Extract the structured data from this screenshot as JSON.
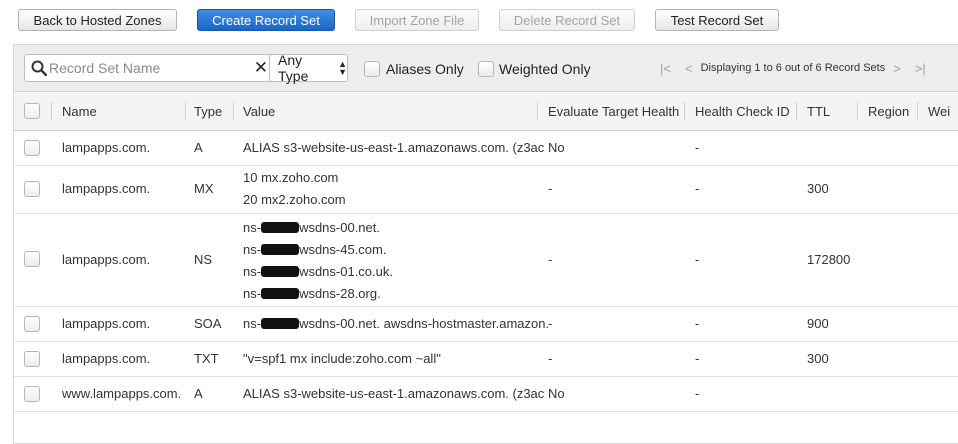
{
  "toolbar": {
    "back": "Back to Hosted Zones",
    "create": "Create Record Set",
    "import": "Import Zone File",
    "delete": "Delete Record Set",
    "test": "Test Record Set"
  },
  "filters": {
    "search_placeholder": "Record Set Name",
    "clear": "✕",
    "type": "Any Type",
    "aliases_only": "Aliases Only",
    "weighted_only": "Weighted Only"
  },
  "pager": {
    "text": "Displaying 1 to 6 out of 6 Record Sets",
    "first": "|<",
    "prev": "<",
    "next": ">",
    "last": ">|"
  },
  "columns": {
    "name": "Name",
    "type": "Type",
    "value": "Value",
    "eval": "Evaluate Target Health",
    "health": "Health Check ID",
    "ttl": "TTL",
    "region": "Region",
    "weight": "Wei"
  },
  "rows": [
    {
      "name": "lampapps.com.",
      "type": "A",
      "value": [
        "ALIAS s3-website-us-east-1.amazonaws.com. (z3ac"
      ],
      "eval": "No",
      "health": "-",
      "ttl": ""
    },
    {
      "name": "lampapps.com.",
      "type": "MX",
      "value": [
        "10 mx.zoho.com",
        "20 mx2.zoho.com"
      ],
      "eval": "-",
      "health": "-",
      "ttl": "300"
    },
    {
      "name": "lampapps.com.",
      "type": "NS",
      "value": [
        {
          "pre": "ns-",
          "post": "wsdns-00.net."
        },
        {
          "pre": "ns-",
          "post": "wsdns-45.com."
        },
        {
          "pre": "ns-",
          "post": "wsdns-01.co.uk."
        },
        {
          "pre": "ns-",
          "post": "wsdns-28.org."
        }
      ],
      "eval": "-",
      "health": "-",
      "ttl": "172800"
    },
    {
      "name": "lampapps.com.",
      "type": "SOA",
      "value": [
        {
          "pre": "ns-",
          "post": "wsdns-00.net. awsdns-hostmaster.amazon."
        }
      ],
      "eval": "-",
      "health": "-",
      "ttl": "900"
    },
    {
      "name": "lampapps.com.",
      "type": "TXT",
      "value": [
        "\"v=spf1 mx include:zoho.com ~all\""
      ],
      "eval": "-",
      "health": "-",
      "ttl": "300"
    },
    {
      "name": "www.lampapps.com.",
      "type": "A",
      "value": [
        "ALIAS s3-website-us-east-1.amazonaws.com. (z3ac"
      ],
      "eval": "No",
      "health": "-",
      "ttl": ""
    }
  ]
}
